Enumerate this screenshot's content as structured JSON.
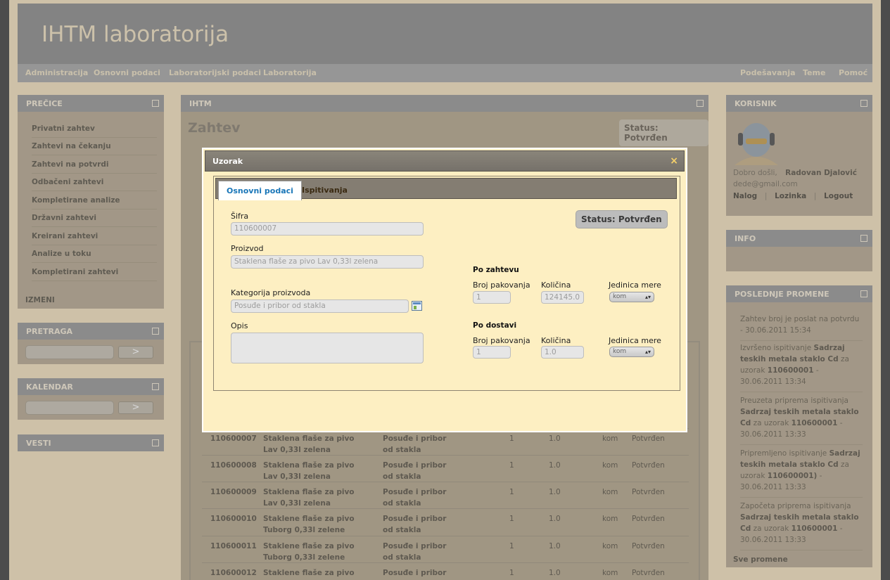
{
  "app": {
    "title": "IHTM laboratorija"
  },
  "nav": {
    "left": [
      "Administracija",
      "Osnovni podaci",
      "Laboratorijski podaci",
      "Laboratorija"
    ],
    "right": [
      "Podešavanja",
      "Teme",
      "Pomoć"
    ]
  },
  "left": {
    "shortcuts_title": "PREČICE",
    "shortcuts": [
      "Privatni zahtev",
      "Zahtevi na čekanju",
      "Zahtevi na potvrdi",
      "Odbačeni zahtevi",
      "Kompletirane analize",
      "Državni zahtevi",
      "Kreirani zahtevi",
      "Analize u toku",
      "Kompletirani zahtevi"
    ],
    "edit_label": "IZMENI",
    "search_title": "PRETRAGA",
    "search_btn": ">",
    "calendar_title": "KALENDAR",
    "calendar_btn": ">",
    "news_title": "VESTI"
  },
  "center": {
    "panel_title": "IHTM",
    "page_title": "Zahtev",
    "status": "Status: Potvrđen",
    "rows": [
      {
        "id": "110600007",
        "product": "Staklena flaše za pivo Lav 0,33l zelena",
        "category": "Posuđe i pribor od stakla",
        "qty": "1",
        "amount": "1.0",
        "unit": "kom",
        "status": "Potvrđen"
      },
      {
        "id": "110600008",
        "product": "Staklena flaše za pivo Lav 0,33l zelena",
        "category": "Posuđe i pribor od stakla",
        "qty": "1",
        "amount": "1.0",
        "unit": "kom",
        "status": "Potvrđen"
      },
      {
        "id": "110600009",
        "product": "Staklena flaše za pivo Lav 0,33l zelena",
        "category": "Posuđe i pribor od stakla",
        "qty": "1",
        "amount": "1.0",
        "unit": "kom",
        "status": "Potvrđen"
      },
      {
        "id": "110600010",
        "product": "Staklene flaše za pivo Tuborg 0,33l zelene",
        "category": "Posuđe i pribor od stakla",
        "qty": "1",
        "amount": "1.0",
        "unit": "kom",
        "status": "Potvrđen"
      },
      {
        "id": "110600011",
        "product": "Staklene flaše za pivo Tuborg 0,33l zelene",
        "category": "Posuđe i pribor od stakla",
        "qty": "1",
        "amount": "1.0",
        "unit": "kom",
        "status": "Potvrđen"
      },
      {
        "id": "110600012",
        "product": "Staklene flaše za pivo",
        "category": "Posuđe i pribor",
        "qty": "1",
        "amount": "1.0",
        "unit": "kom",
        "status": "Potvrđen"
      }
    ]
  },
  "right": {
    "user_title": "KORISNIK",
    "welcome": "Dobro došli,",
    "user_name": "Radovan Djalović",
    "email": "dede@gmail.com",
    "links": [
      "Nalog",
      "Lozinka",
      "Logout"
    ],
    "info_title": "INFO",
    "changes_title": "POSLEDNJE PROMENE",
    "changes": [
      [
        {
          "t": "Zahtev broj je poslat na potvrdu - 30.06.2011 15:34",
          "b": false
        }
      ],
      [
        {
          "t": "Izvršeno ispitivanje ",
          "b": false
        },
        {
          "t": "Sadrzaj teskih metala staklo Cd",
          "b": true
        },
        {
          "t": " za uzorak ",
          "b": false
        },
        {
          "t": "110600001",
          "b": true
        },
        {
          "t": " - 30.06.2011 13:34",
          "b": false
        }
      ],
      [
        {
          "t": "Preuzeta priprema ispitivanja ",
          "b": false
        },
        {
          "t": "Sadrzaj teskih metala staklo Cd",
          "b": true
        },
        {
          "t": " za uzorak ",
          "b": false
        },
        {
          "t": "110600001",
          "b": true
        },
        {
          "t": " - 30.06.2011 13:33",
          "b": false
        }
      ],
      [
        {
          "t": "Pripremljeno ispitivanje ",
          "b": false
        },
        {
          "t": "Sadrzaj teskih metala staklo Cd",
          "b": true
        },
        {
          "t": " za uzorak ",
          "b": false
        },
        {
          "t": "110600001)",
          "b": true
        },
        {
          "t": " - 30.06.2011 13:33",
          "b": false
        }
      ],
      [
        {
          "t": "Započeta priprema ispitivanja ",
          "b": false
        },
        {
          "t": "Sadrzaj teskih metala staklo Cd",
          "b": true
        },
        {
          "t": " za uzorak ",
          "b": false
        },
        {
          "t": "110600001",
          "b": true
        },
        {
          "t": " - 30.06.2011 13:33",
          "b": false
        }
      ]
    ],
    "all_changes": "Sve promene"
  },
  "dialog": {
    "title": "Uzorak",
    "close": "×",
    "tabs": [
      "Osnovni podaci",
      "Ispitivanja"
    ],
    "sifra_label": "Šifra",
    "sifra_value": "110600007",
    "proizvod_label": "Proizvod",
    "proizvod_value": "Staklena flaše za pivo Lav 0,33l zelena",
    "kategorija_label": "Kategorija proizvoda",
    "kategorija_value": "Posuđe i pribor od stakla",
    "opis_label": "Opis",
    "opis_value": "",
    "status": "Status: Potvrđen",
    "po_zahtevu": "Po zahtevu",
    "po_dostavi": "Po dostavi",
    "col_pack": "Broj pakovanja",
    "col_qty": "Količina",
    "col_unit": "Jedinica mere",
    "z_pack": "1",
    "z_qty": "124145.0",
    "z_unit": "kom",
    "d_pack": "1",
    "d_qty": "1.0",
    "d_unit": "kom"
  },
  "colors": {
    "overlay": "#8a8a8a",
    "dialog_bg": "#fdefc2",
    "tab_active_text": "#1976b8"
  }
}
